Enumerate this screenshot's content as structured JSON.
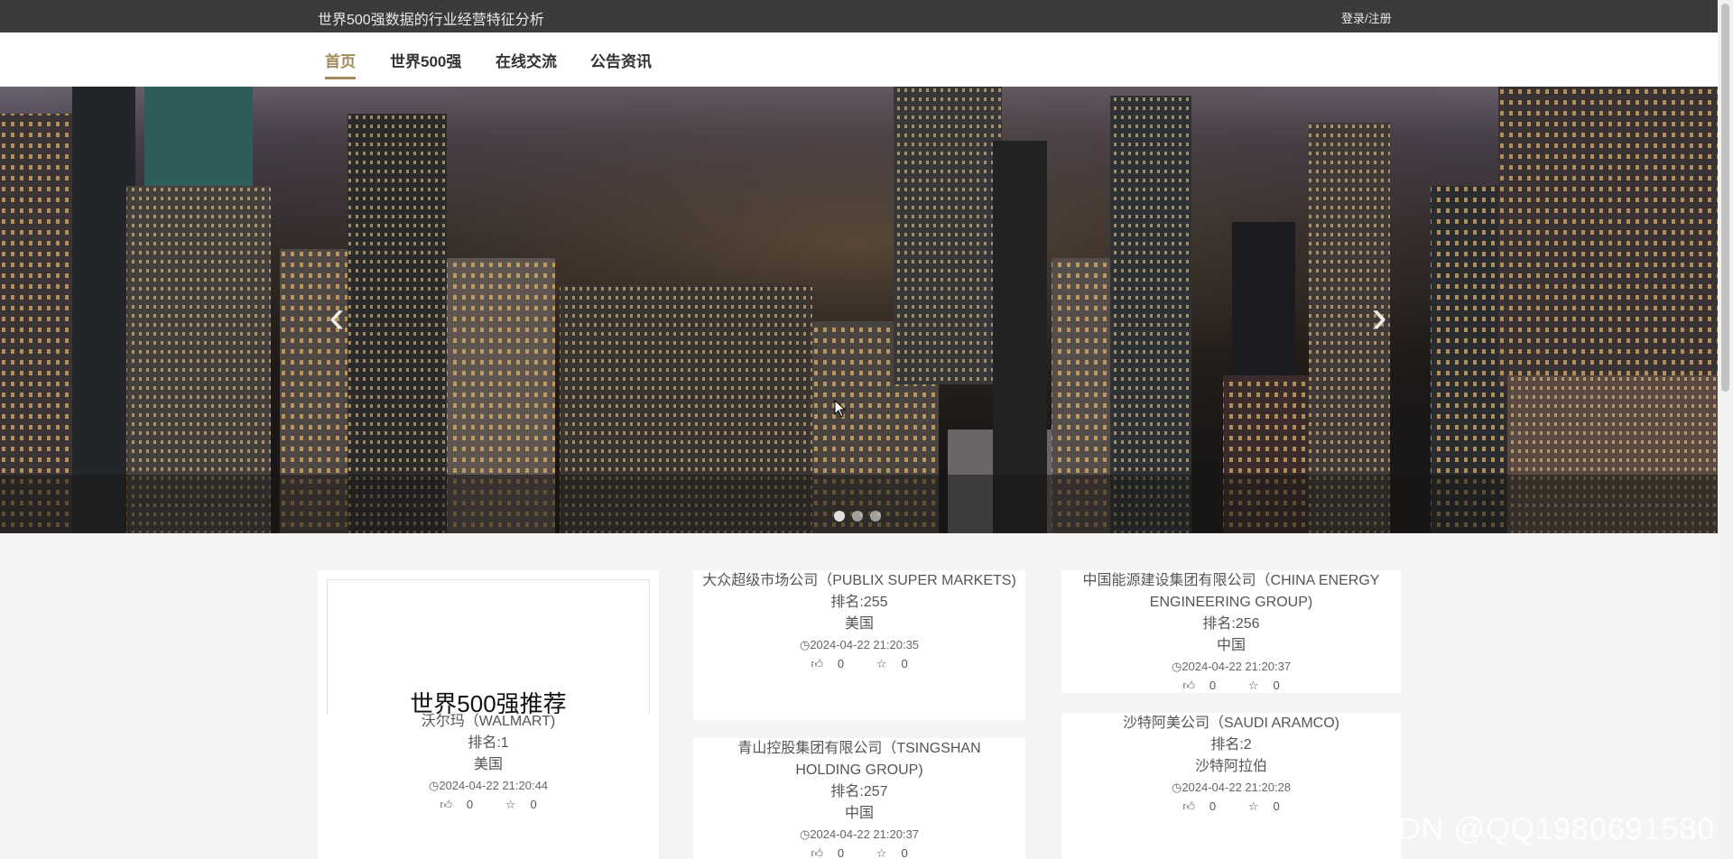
{
  "header": {
    "site_title": "世界500强数据的行业经营特征分析",
    "login": "登录/注册"
  },
  "nav": {
    "items": [
      "首页",
      "世界500强",
      "在线交流",
      "公告资讯"
    ],
    "active_index": 0
  },
  "banner": {
    "prev": "‹",
    "next": "›",
    "dots": 3,
    "active_dot": 0
  },
  "featured": {
    "heading": "世界500强推荐",
    "name": "沃尔玛（WALMART)",
    "rank": "排名:1",
    "country": "美国",
    "time": "2024-04-22 21:20:44",
    "likes": "0",
    "favs": "0"
  },
  "cards": [
    {
      "name": "大众超级市场公司（PUBLIX SUPER MARKETS)",
      "rank": "排名:255",
      "country": "美国",
      "time": "2024-04-22 21:20:35",
      "likes": "0",
      "favs": "0"
    },
    {
      "name": "中国能源建设集团有限公司（CHINA ENERGY ENGINEERING GROUP)",
      "rank": "排名:256",
      "country": "中国",
      "time": "2024-04-22 21:20:37",
      "likes": "0",
      "favs": "0"
    },
    {
      "name": "青山控股集团有限公司（TSINGSHAN HOLDING GROUP)",
      "rank": "排名:257",
      "country": "中国",
      "time": "2024-04-22 21:20:37",
      "likes": "0",
      "favs": "0"
    },
    {
      "name": "沙特阿美公司（SAUDI ARAMCO)",
      "rank": "排名:2",
      "country": "沙特阿拉伯",
      "time": "2024-04-22 21:20:28",
      "likes": "0",
      "favs": "0"
    }
  ],
  "watermark": "CSDN @QQ1980691580",
  "colors": {
    "accent": "#a48a5c",
    "topbar": "#3b3b3b"
  }
}
